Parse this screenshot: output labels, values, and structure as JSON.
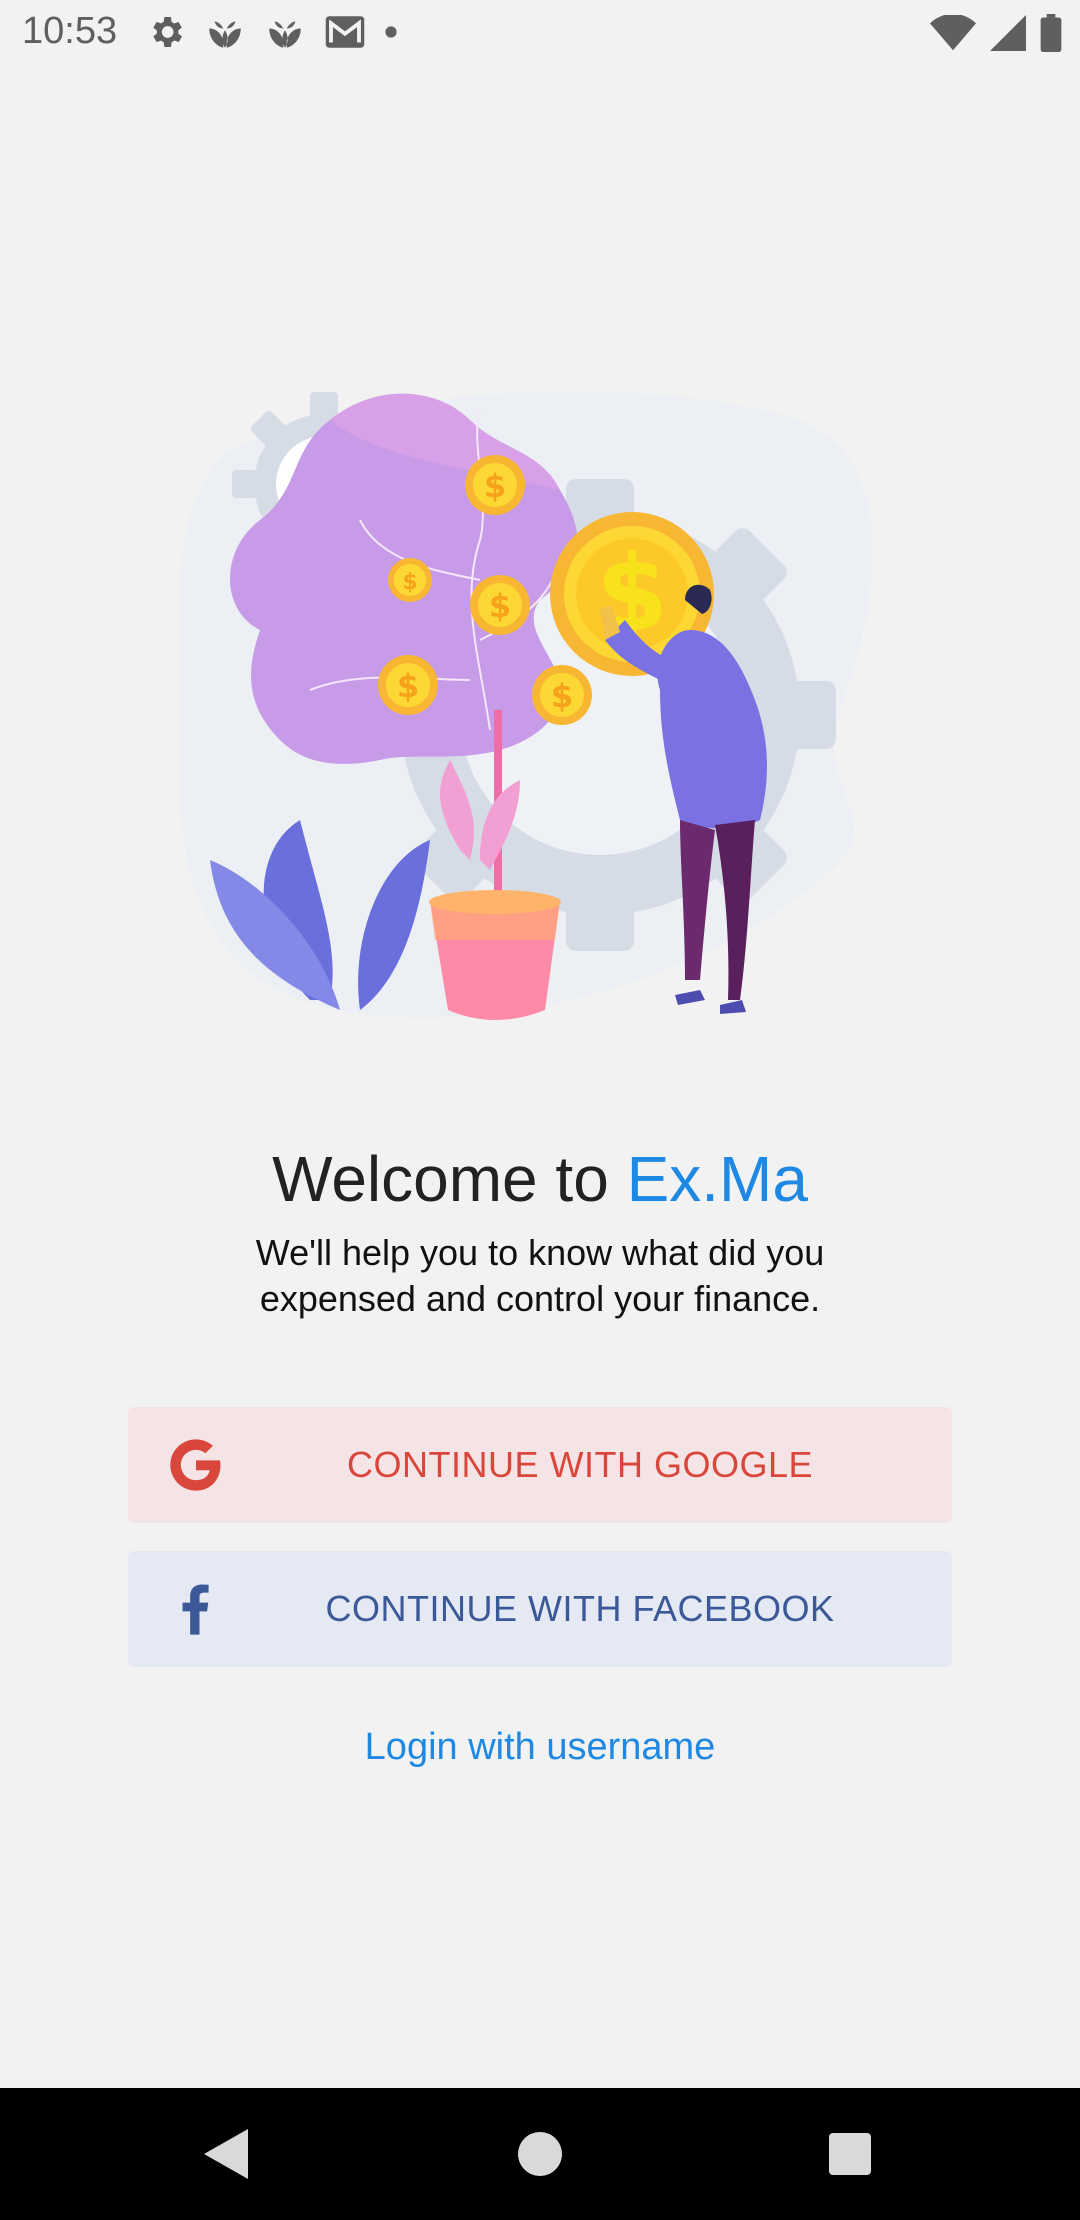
{
  "status_bar": {
    "time": "10:53",
    "left_icons": [
      "settings-icon",
      "leaf-app-icon",
      "leaf-app-icon",
      "gmail-icon",
      "dot-icon"
    ],
    "right_icons": [
      "wifi-icon",
      "signal-icon",
      "battery-icon"
    ]
  },
  "welcome": {
    "title_prefix": "Welcome to ",
    "brand_name": "Ex.Ma",
    "subtitle_line1": "We'll help you to know what did you",
    "subtitle_line2": "expensed and control your finance."
  },
  "buttons": {
    "google_label": "CONTINUE WITH GOOGLE",
    "facebook_label": "CONTINUE WITH FACEBOOK",
    "login_username_label": "Login with username"
  },
  "colors": {
    "brand_blue": "#1e88e5",
    "google_red": "#d9473c",
    "facebook_blue": "#3b5998",
    "google_bg": "#f5e4e6",
    "facebook_bg": "#e4e9f3"
  },
  "nav_bar": {
    "icons": [
      "back-icon",
      "home-icon",
      "recents-icon"
    ]
  }
}
